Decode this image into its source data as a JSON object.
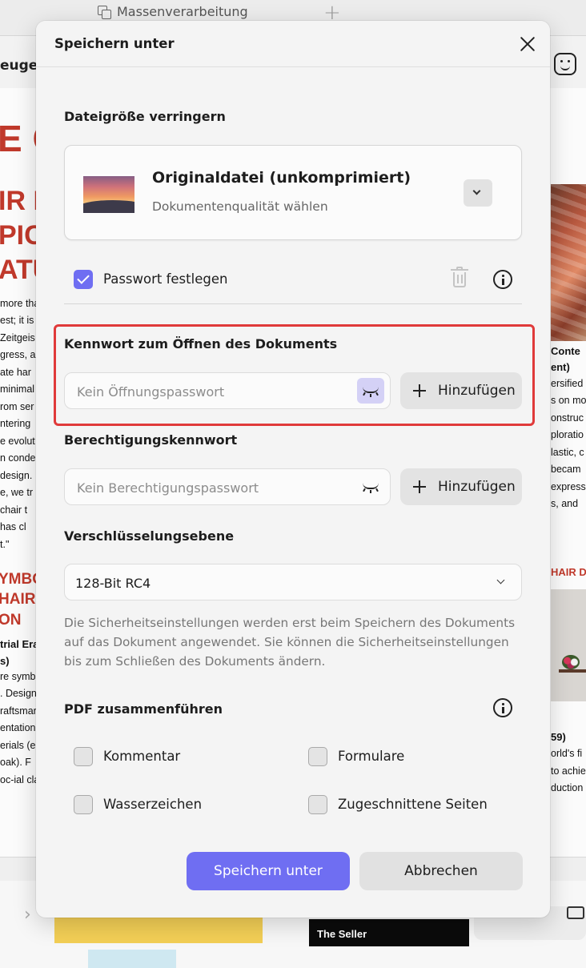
{
  "background": {
    "tab_label": "Massenverarbeitung",
    "toolbar_label": "euge",
    "left_page": {
      "heading_red": [
        "E C",
        "IR D",
        "PIC",
        "ATU"
      ],
      "body_lines": [
        "more tha",
        "est; it is",
        "Zeitgeis",
        "gress, a",
        "ate har",
        "minimal",
        "rom ser",
        "ntering",
        "e evolut",
        "n conde",
        "design.",
        "e, we tr",
        "chair t",
        "has cl",
        "t.\""
      ],
      "section_red": [
        "YMBOL",
        "HAIR D",
        "ON"
      ],
      "sub_bold": [
        "trial Era",
        "s)"
      ],
      "body_lines_2": [
        "re symb",
        ". Design",
        "raftsmar",
        "entation",
        "erials (e",
        "oak). F",
        "oc-ial cla"
      ]
    },
    "right_page": {
      "bold_lines": [
        "Conte",
        "ent)"
      ],
      "body_lines": [
        "ersified",
        "s on mo",
        "onstruc",
        "ploratio",
        "lastic, c",
        "becam",
        "express",
        "s, and"
      ],
      "section_red": "HAIR DES",
      "sub_bold": "59)",
      "body_lines_2": [
        "orld's fi",
        "to achie",
        "duction"
      ]
    },
    "seller_text": "The Seller"
  },
  "dialog": {
    "title": "Speichern unter",
    "reduce_size": {
      "heading": "Dateigröße verringern",
      "selected_title": "Originaldatei (unkomprimiert)",
      "selected_subtitle": "Dokumentenqualität wählen"
    },
    "password": {
      "checkbox_label": "Passwort festlegen",
      "checked": true,
      "open_heading": "Kennwort zum Öffnen des Dokuments",
      "open_placeholder": "Kein Öffnungspasswort",
      "permission_heading": "Berechtigungskennwort",
      "permission_placeholder": "Kein Berechtigungspasswort",
      "add_label": "Hinzufügen"
    },
    "encryption": {
      "heading": "Verschlüsselungsebene",
      "value": "128-Bit RC4",
      "note": "Die Sicherheitseinstellungen werden erst beim Speichern des Dokuments auf das Dokument angewendet. Sie können die Sicherheitseinstellungen bis zum Schließen des Dokuments ändern."
    },
    "merge": {
      "heading": "PDF zusammenführen",
      "options": [
        {
          "label": "Kommentar",
          "checked": false
        },
        {
          "label": "Formulare",
          "checked": false
        },
        {
          "label": "Wasserzeichen",
          "checked": false
        },
        {
          "label": "Zugeschnittene Seiten",
          "checked": false
        }
      ]
    },
    "buttons": {
      "save": "Speichern unter",
      "cancel": "Abbrechen"
    }
  },
  "colors": {
    "accent": "#6f6ef2",
    "highlight": "#e03a3a",
    "background_red_text": "#c0392b"
  }
}
